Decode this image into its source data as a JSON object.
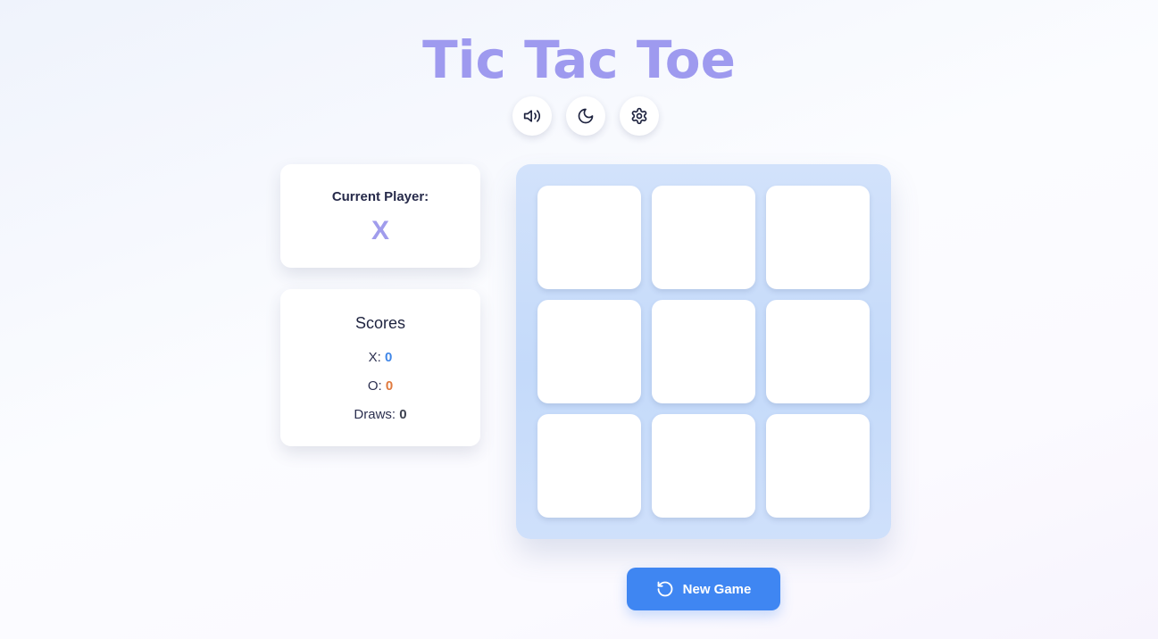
{
  "app": {
    "title": "Tic Tac Toe"
  },
  "toolbar": {
    "buttons": [
      {
        "icon": "sound-icon"
      },
      {
        "icon": "moon-icon"
      },
      {
        "icon": "gear-icon"
      }
    ]
  },
  "status": {
    "label": "Current Player:",
    "current_player": "X"
  },
  "scores": {
    "title": "Scores",
    "x_label": "X:",
    "x_value": "0",
    "o_label": "O:",
    "o_value": "0",
    "draws_label": "Draws:",
    "draws_value": "0"
  },
  "board": {
    "cells": [
      "",
      "",
      "",
      "",
      "",
      "",
      "",
      "",
      ""
    ]
  },
  "actions": {
    "new_game_label": "New Game",
    "new_game_icon": "restart-icon"
  },
  "colors": {
    "title": "#9e9aef",
    "accent": "#3f86f2",
    "x_score": "#3f86e8",
    "o_score": "#e0793d",
    "board_bg": "#c8dcfa"
  }
}
